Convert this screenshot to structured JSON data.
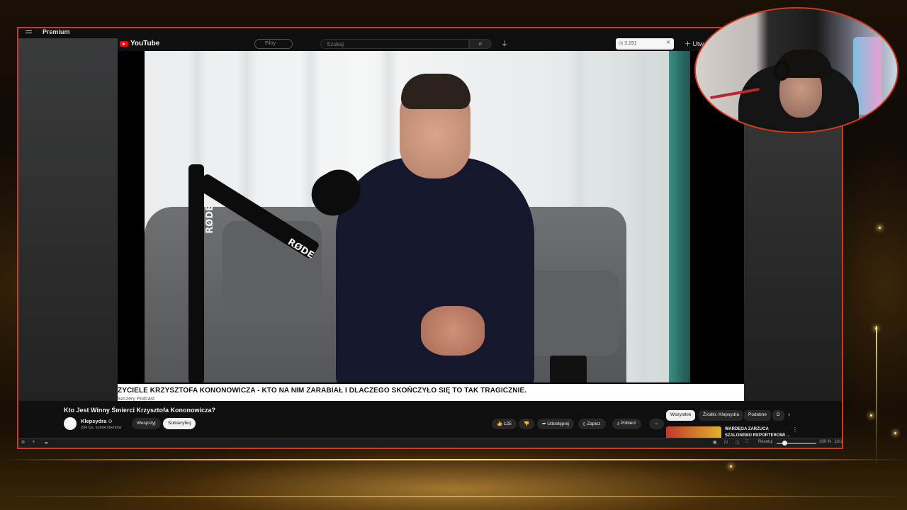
{
  "outer_youtube": {
    "premium_label": "Premium"
  },
  "inner_youtube": {
    "logo_text": "YouTube",
    "filter_placeholder": "Filtry",
    "search_placeholder": "Szukaj",
    "extension_count": "3,191",
    "create_label": "Utw"
  },
  "video": {
    "subtitle_text": "ZYCIELE KRZYSZTOFA KONONOWICZA - KTO NA NIM ZARABIAŁ I DLACZEGO SKOŃCZYŁO SIĘ TO TAK TRAGICZNIE.",
    "subtitle_channel": "Szczery Podcast",
    "mic_brand": "RØDE"
  },
  "watch": {
    "title": "Kto Jest Winny Śmierci Krzysztofa Kononowicza?",
    "channel_name": "Klepsydra",
    "channel_verified": "⊙",
    "subscribers": "294 tys. subskrybentów",
    "support_label": "Wesprzyj",
    "subscribe_label": "Subskrybuj",
    "like_count": "125",
    "share_label": "Udostępnij",
    "save_label": "Zapisz",
    "download_label": "Pobierz",
    "more_label": "⋯"
  },
  "recommendations": {
    "chips": [
      "Wszystkie",
      "Źródło: Klepsydra",
      "Podobne",
      "D"
    ],
    "active_chip": "Wszystkie",
    "first_title_line1": "WARDĘGA ZARZUCA",
    "first_title_line2": "SZALONEMU REPORTEROWI ..."
  },
  "statusbar": {
    "reset_label": "Resetuj",
    "zoom_percent": "100 %",
    "time": "16:2"
  },
  "colors": {
    "frame_border": "#d43a1a",
    "youtube_red": "#ff0000",
    "gold": "#ffd27a"
  }
}
